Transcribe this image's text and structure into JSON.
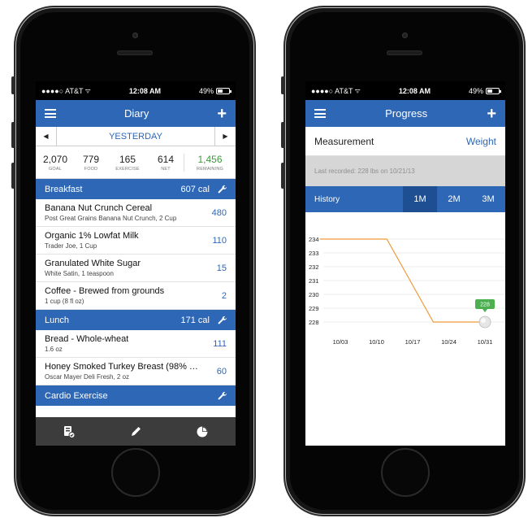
{
  "status": {
    "carrier": "●●●●○ AT&T",
    "time": "12:08 AM",
    "battery": "49%",
    "battery_fraction": 0.49
  },
  "diary": {
    "nav": {
      "title": "Diary",
      "menu_icon": "hamburger-icon",
      "add_icon": "plus-icon"
    },
    "date": {
      "label": "YESTERDAY",
      "prev": "◀",
      "next": "▶"
    },
    "summary": {
      "goal": {
        "value": "2,070",
        "label": "GOAL"
      },
      "food": {
        "value": "779",
        "label": "FOOD"
      },
      "exercise": {
        "value": "165",
        "label": "EXERCISE"
      },
      "net": {
        "value": "614",
        "label": "NET"
      },
      "remaining": {
        "value": "1,456",
        "label": "REMAINING"
      }
    },
    "breakfast": {
      "title": "Breakfast",
      "calories": "607 cal",
      "items": [
        {
          "name": "Banana Nut Crunch Cereal",
          "desc": "Post Great Grains Banana Nut Crunch, 2 Cup",
          "cal": "480"
        },
        {
          "name": "Organic 1% Lowfat Milk",
          "desc": "Trader Joe, 1 Cup",
          "cal": "110"
        },
        {
          "name": "Granulated White Sugar",
          "desc": "White Satin, 1 teaspoon",
          "cal": "15"
        },
        {
          "name": "Coffee - Brewed from grounds",
          "desc": "1 cup (8 fl oz)",
          "cal": "2"
        }
      ]
    },
    "lunch": {
      "title": "Lunch",
      "calories": "171 cal",
      "items": [
        {
          "name": "Bread - Whole-wheat",
          "desc": "1.6 oz",
          "cal": "111"
        },
        {
          "name": "Honey Smoked Turkey Breast (98% F...",
          "desc": "Oscar Mayer Deli Fresh, 2 oz",
          "cal": "60"
        }
      ]
    },
    "cardio": {
      "title": "Cardio Exercise"
    },
    "tabbar": {
      "icons": [
        "diary-icon",
        "edit-icon",
        "pie-chart-icon"
      ]
    }
  },
  "progress": {
    "nav": {
      "title": "Progress",
      "menu_icon": "hamburger-icon",
      "add_icon": "plus-icon"
    },
    "measurement": {
      "label": "Measurement",
      "value": "Weight"
    },
    "last_recorded": "Last recorded: 228 lbs on 10/21/13",
    "history": {
      "label": "History",
      "tabs": [
        "1M",
        "2M",
        "3M"
      ],
      "active": "1M"
    },
    "colors": {
      "brand_blue": "#2d67b6",
      "line": "#ef9a3b",
      "badge": "#4caf50",
      "remaining_green": "#3e9a3c"
    }
  },
  "chart_data": {
    "type": "line",
    "x": [
      "09/29",
      "10/10",
      "10/12",
      "10/21",
      "10/31"
    ],
    "y": [
      234,
      234,
      234,
      228,
      228
    ],
    "x_tick_labels": [
      "10/03",
      "10/10",
      "10/17",
      "10/24",
      "10/31"
    ],
    "y_tick_labels": [
      "234",
      "233",
      "232",
      "231",
      "230",
      "229",
      "228"
    ],
    "ylim": [
      228,
      234
    ],
    "grid": true,
    "annotation": {
      "x": "10/31",
      "y": 228,
      "label": "228"
    }
  }
}
